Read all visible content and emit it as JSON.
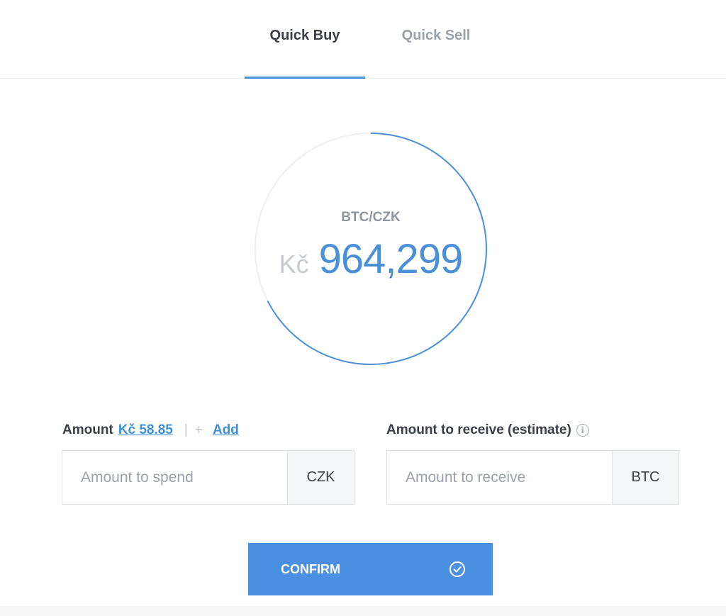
{
  "tabs": {
    "buy_label": "Quick Buy",
    "sell_label": "Quick Sell"
  },
  "ticker": {
    "pair": "BTC/CZK",
    "currency_symbol": "Kč",
    "price": "964,299"
  },
  "spend": {
    "label": "Amount",
    "balance_link": "Kč 58.85",
    "separator": "|",
    "plus": "+",
    "add_link": "Add",
    "placeholder": "Amount to spend",
    "unit": "CZK"
  },
  "receive": {
    "label": "Amount to receive (estimate)",
    "info_glyph": "i",
    "placeholder": "Amount to receive",
    "unit": "BTC"
  },
  "confirm": {
    "label": "CONFIRM",
    "icon": "check-circle-icon"
  },
  "colors": {
    "accent": "#4a90e2",
    "link": "#3f8fd9",
    "ring_track": "#eef0f2"
  }
}
